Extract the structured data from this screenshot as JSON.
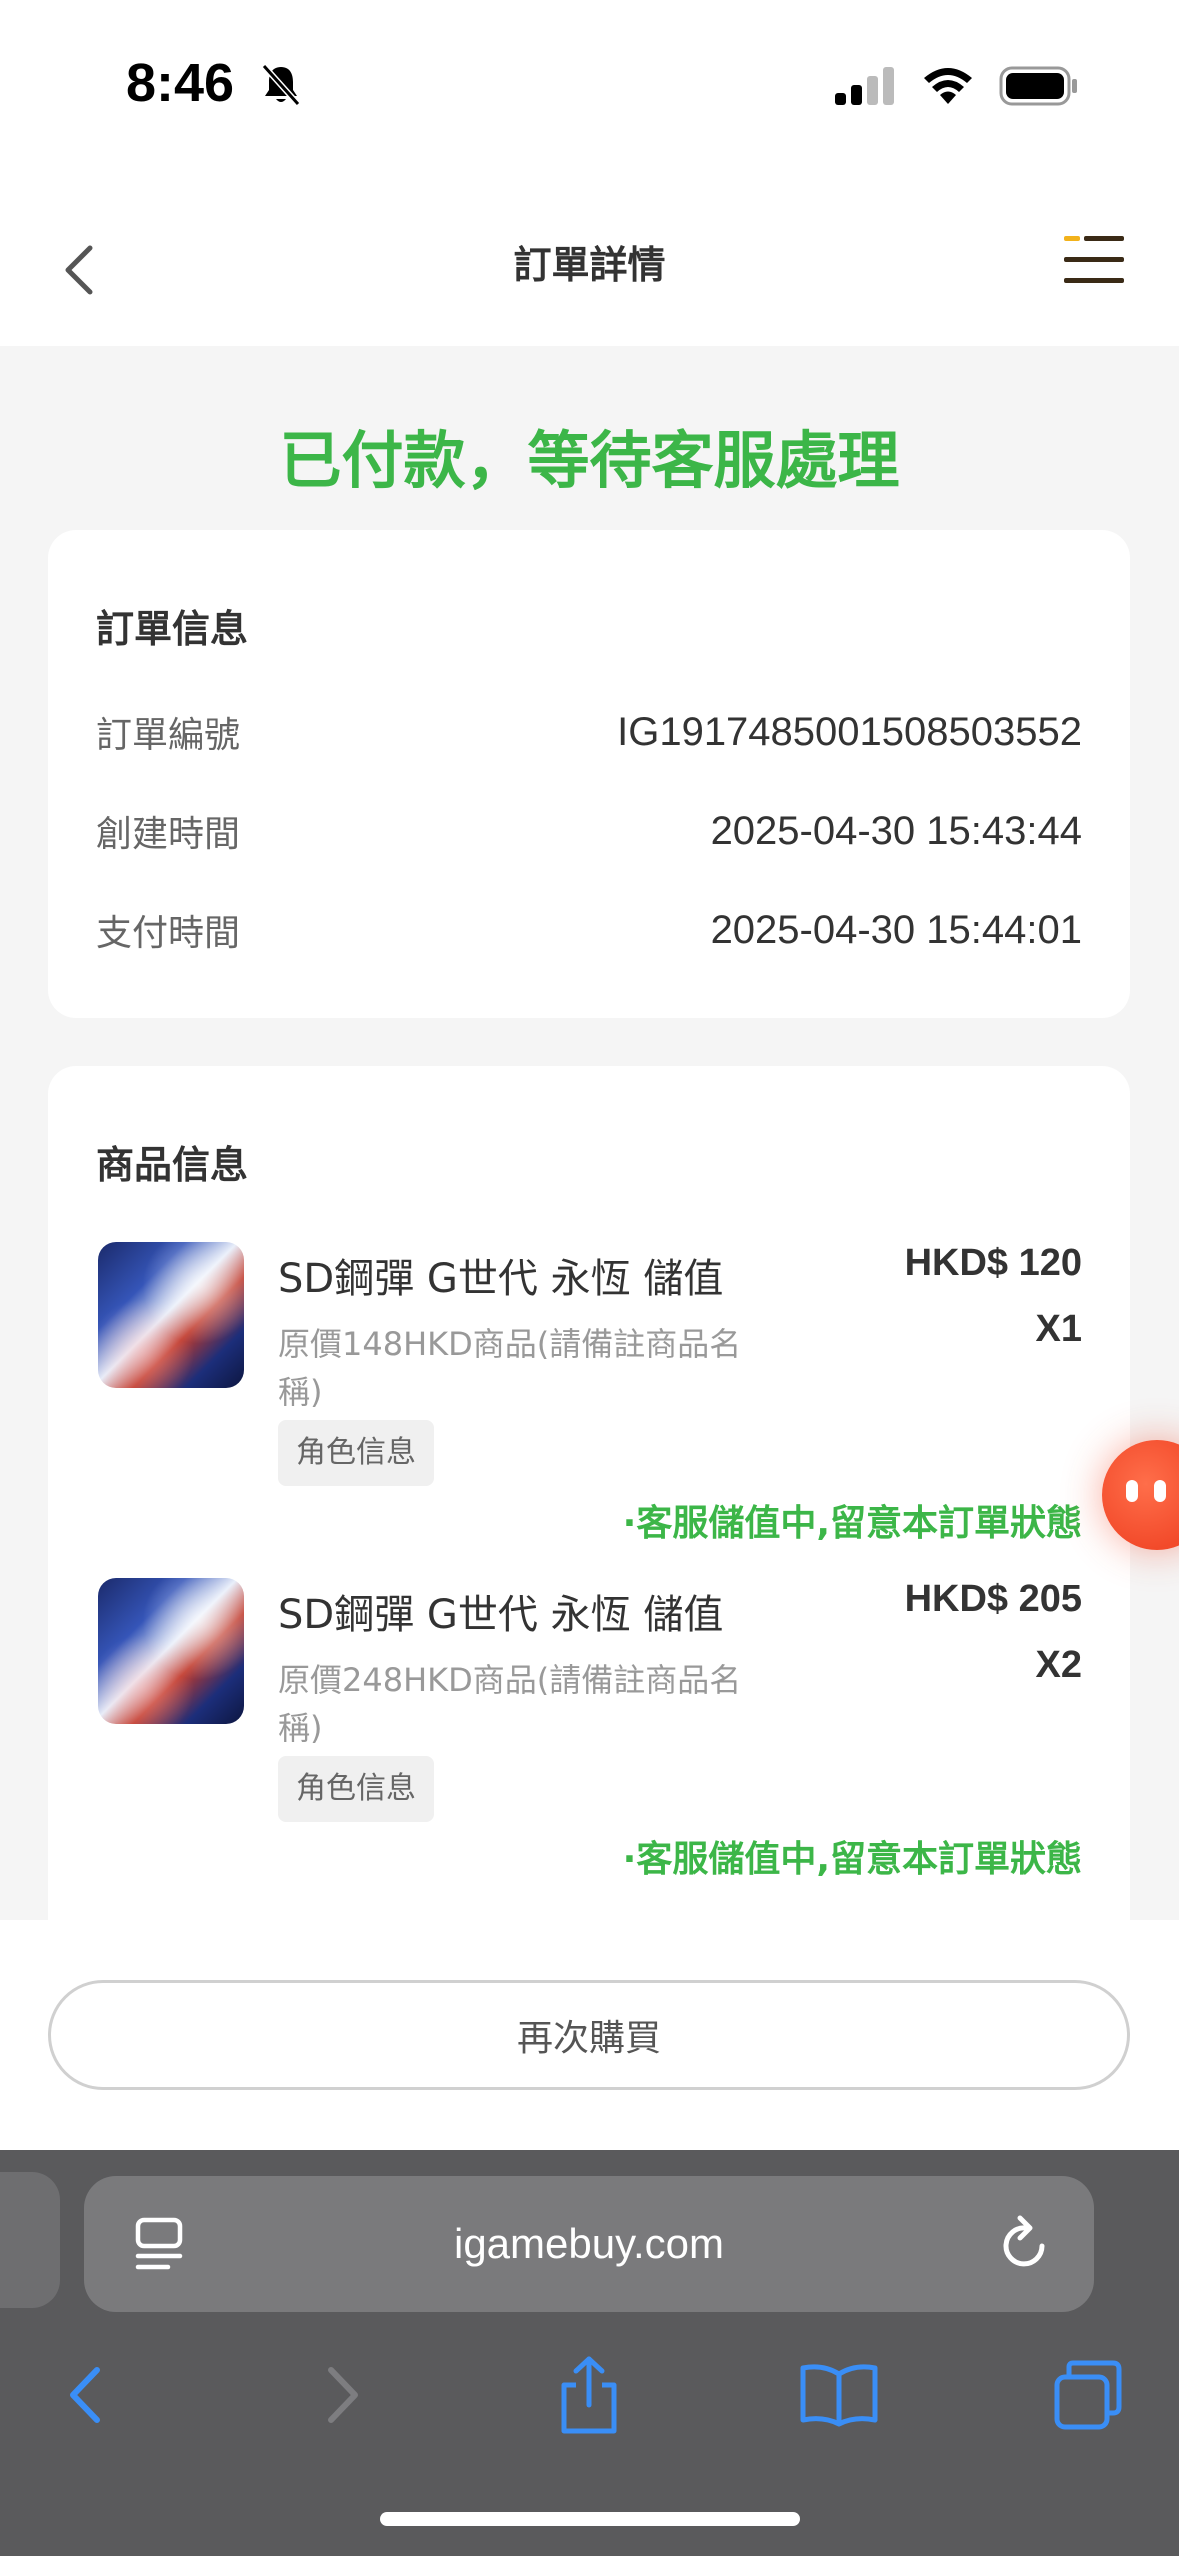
{
  "status_bar": {
    "time": "8:46"
  },
  "nav": {
    "title": "訂單詳情"
  },
  "order_status": "已付款，等待客服處理",
  "order_info": {
    "title": "訂單信息",
    "rows": [
      {
        "label": "訂單編號",
        "value": "IG1917485001508503552"
      },
      {
        "label": "創建時間",
        "value": "2025-04-30 15:43:44"
      },
      {
        "label": "支付時間",
        "value": "2025-04-30 15:44:01"
      }
    ]
  },
  "product_info": {
    "title": "商品信息",
    "items": [
      {
        "name": "SD鋼彈 G世代 永恆 儲值",
        "desc": "原價148HKD商品(請備註商品名稱)",
        "tag": "角色信息",
        "price": "HKD$ 120",
        "qty": "X1",
        "status": "·客服儲值中,留意本訂單狀態"
      },
      {
        "name": "SD鋼彈 G世代 永恆 儲值",
        "desc": "原價248HKD商品(請備註商品名稱)",
        "tag": "角色信息",
        "price": "HKD$ 205",
        "qty": "X2",
        "status": "·客服儲值中,留意本訂單狀態"
      }
    ]
  },
  "actions": {
    "buy_again": "再次購買"
  },
  "browser": {
    "url": "igamebuy.com"
  },
  "colors": {
    "accent_green": "#3cb648",
    "safari_blue": "#3a8ef6"
  }
}
